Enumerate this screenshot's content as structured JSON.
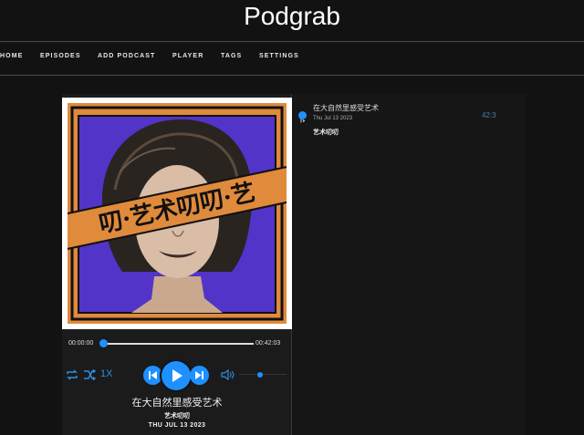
{
  "app": {
    "title": "Podgrab"
  },
  "nav": {
    "items": [
      "HOME",
      "EPISODES",
      "ADD PODCAST",
      "PLAYER",
      "TAGS",
      "SETTINGS"
    ]
  },
  "player": {
    "artwork_text": "叨·艺术叨叨·艺",
    "current_time": "00:00:00",
    "total_time": "00:42:03",
    "progress_fraction": 0.0,
    "speed_label": "1X",
    "volume_fraction": 0.45,
    "now_playing": {
      "title": "在大自然里感受艺术",
      "podcast": "艺术叨叨",
      "date": "THU JUL 13 2023"
    }
  },
  "playlist": {
    "items": [
      {
        "title": "在大自然里感受艺术",
        "date": "Thu Jul 13 2023",
        "podcast": "艺术叨叨",
        "duration": "42:3"
      }
    ]
  },
  "colors": {
    "accent": "#1e90ff",
    "background": "#121212",
    "frame_orange": "#e08a3c",
    "frame_purple": "#5234c8"
  }
}
